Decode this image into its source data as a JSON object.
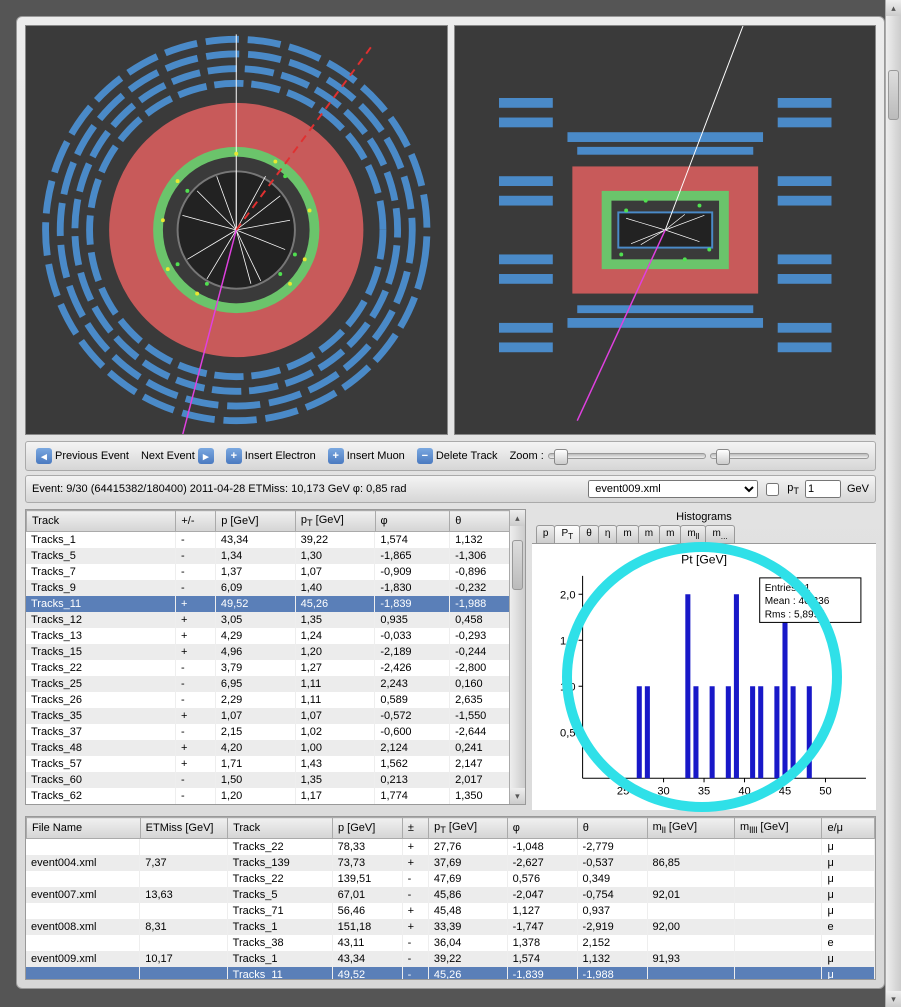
{
  "toolbar": {
    "prev": "Previous Event",
    "next": "Next Event",
    "ins_e": "Insert Electron",
    "ins_mu": "Insert Muon",
    "del": "Delete Track",
    "zoom": "Zoom :"
  },
  "infobar": {
    "text": "Event: 9/30 (64415382/180400)  2011-04-28   ETMiss: 10,173 GeV   φ: 0,85 rad",
    "file": "event009.xml",
    "pt_label": "p",
    "pt_sub": "T",
    "pt_val": "1",
    "pt_unit": "GeV"
  },
  "tracks": {
    "headers": [
      "Track",
      "+/-",
      "p [GeV]",
      "p_T [GeV]",
      "φ",
      "θ"
    ],
    "rows": [
      [
        "Tracks_1",
        "-",
        "43,34",
        "39,22",
        "1,574",
        "1,132"
      ],
      [
        "Tracks_5",
        "-",
        "1,34",
        "1,30",
        "-1,865",
        "-1,306"
      ],
      [
        "Tracks_7",
        "-",
        "1,37",
        "1,07",
        "-0,909",
        "-0,896"
      ],
      [
        "Tracks_9",
        "-",
        "6,09",
        "1,40",
        "-1,830",
        "-0,232"
      ],
      [
        "Tracks_11",
        "+",
        "49,52",
        "45,26",
        "-1,839",
        "-1,988"
      ],
      [
        "Tracks_12",
        "+",
        "3,05",
        "1,35",
        "0,935",
        "0,458"
      ],
      [
        "Tracks_13",
        "+",
        "4,29",
        "1,24",
        "-0,033",
        "-0,293"
      ],
      [
        "Tracks_15",
        "+",
        "4,96",
        "1,20",
        "-2,189",
        "-0,244"
      ],
      [
        "Tracks_22",
        "-",
        "3,79",
        "1,27",
        "-2,426",
        "-2,800"
      ],
      [
        "Tracks_25",
        "-",
        "6,95",
        "1,11",
        "2,243",
        "0,160"
      ],
      [
        "Tracks_26",
        "-",
        "2,29",
        "1,11",
        "0,589",
        "2,635"
      ],
      [
        "Tracks_35",
        "+",
        "1,07",
        "1,07",
        "-0,572",
        "-1,550"
      ],
      [
        "Tracks_37",
        "-",
        "2,15",
        "1,02",
        "-0,600",
        "-2,644"
      ],
      [
        "Tracks_48",
        "+",
        "4,20",
        "1,00",
        "2,124",
        "0,241"
      ],
      [
        "Tracks_57",
        "+",
        "1,71",
        "1,43",
        "1,562",
        "2,147"
      ],
      [
        "Tracks_60",
        "-",
        "1,50",
        "1,35",
        "0,213",
        "2,017"
      ],
      [
        "Tracks_62",
        "-",
        "1,20",
        "1,17",
        "1,774",
        "1,350"
      ]
    ],
    "selected": 4
  },
  "histograms": {
    "title": "Histograms",
    "tabs": [
      "p",
      "P_T",
      "θ",
      "η",
      "m",
      "m",
      "m",
      "m_ll",
      "m_..."
    ],
    "active": 1
  },
  "chart_data": {
    "type": "bar",
    "title": "Pt [GeV]",
    "xlabel": "",
    "ylabel": "",
    "xlim": [
      20,
      55
    ],
    "ylim": [
      0,
      2.2
    ],
    "xticks": [
      25,
      30,
      35,
      40,
      45,
      50
    ],
    "yticks": [
      0.5,
      1.0,
      1.5,
      2.0
    ],
    "stats": {
      "Entries": "1",
      "Mean": "40,336",
      "Rms": "5,8995"
    },
    "x": [
      27,
      28,
      33,
      34,
      36,
      38,
      39,
      41,
      42,
      44,
      45,
      46,
      48
    ],
    "values": [
      1.0,
      1.0,
      2.0,
      1.0,
      1.0,
      1.0,
      2.0,
      1.0,
      1.0,
      1.0,
      2.0,
      1.0,
      1.0
    ]
  },
  "events": {
    "headers": [
      "File Name",
      "ETMiss [GeV]",
      "Track",
      "p [GeV]",
      "±",
      "p_T [GeV]",
      "φ",
      "θ",
      "m_ll [GeV]",
      "m_llll [GeV]",
      "e/μ"
    ],
    "rows": [
      [
        "",
        "",
        "Tracks_22",
        "78,33",
        "+",
        "27,76",
        "-1,048",
        "-2,779",
        "",
        "",
        "μ"
      ],
      [
        "event004.xml",
        "7,37",
        "Tracks_139",
        "73,73",
        "+",
        "37,69",
        "-2,627",
        "-0,537",
        "86,85",
        "",
        "μ"
      ],
      [
        "",
        "",
        "Tracks_22",
        "139,51",
        "-",
        "47,69",
        "0,576",
        "0,349",
        "",
        "",
        "μ"
      ],
      [
        "event007.xml",
        "13,63",
        "Tracks_5",
        "67,01",
        "-",
        "45,86",
        "-2,047",
        "-0,754",
        "92,01",
        "",
        "μ"
      ],
      [
        "",
        "",
        "Tracks_71",
        "56,46",
        "+",
        "45,48",
        "1,127",
        "0,937",
        "",
        "",
        "μ"
      ],
      [
        "event008.xml",
        "8,31",
        "Tracks_1",
        "151,18",
        "+",
        "33,39",
        "-1,747",
        "-2,919",
        "92,00",
        "",
        "e"
      ],
      [
        "",
        "",
        "Tracks_38",
        "43,11",
        "-",
        "36,04",
        "1,378",
        "2,152",
        "",
        "",
        "e"
      ],
      [
        "event009.xml",
        "10,17",
        "Tracks_1",
        "43,34",
        "-",
        "39,22",
        "1,574",
        "1,132",
        "91,93",
        "",
        "μ"
      ],
      [
        "",
        "",
        "Tracks_11",
        "49,52",
        "-",
        "45,26",
        "-1,839",
        "-1,988",
        "",
        "",
        "μ"
      ]
    ],
    "selected": 8
  }
}
